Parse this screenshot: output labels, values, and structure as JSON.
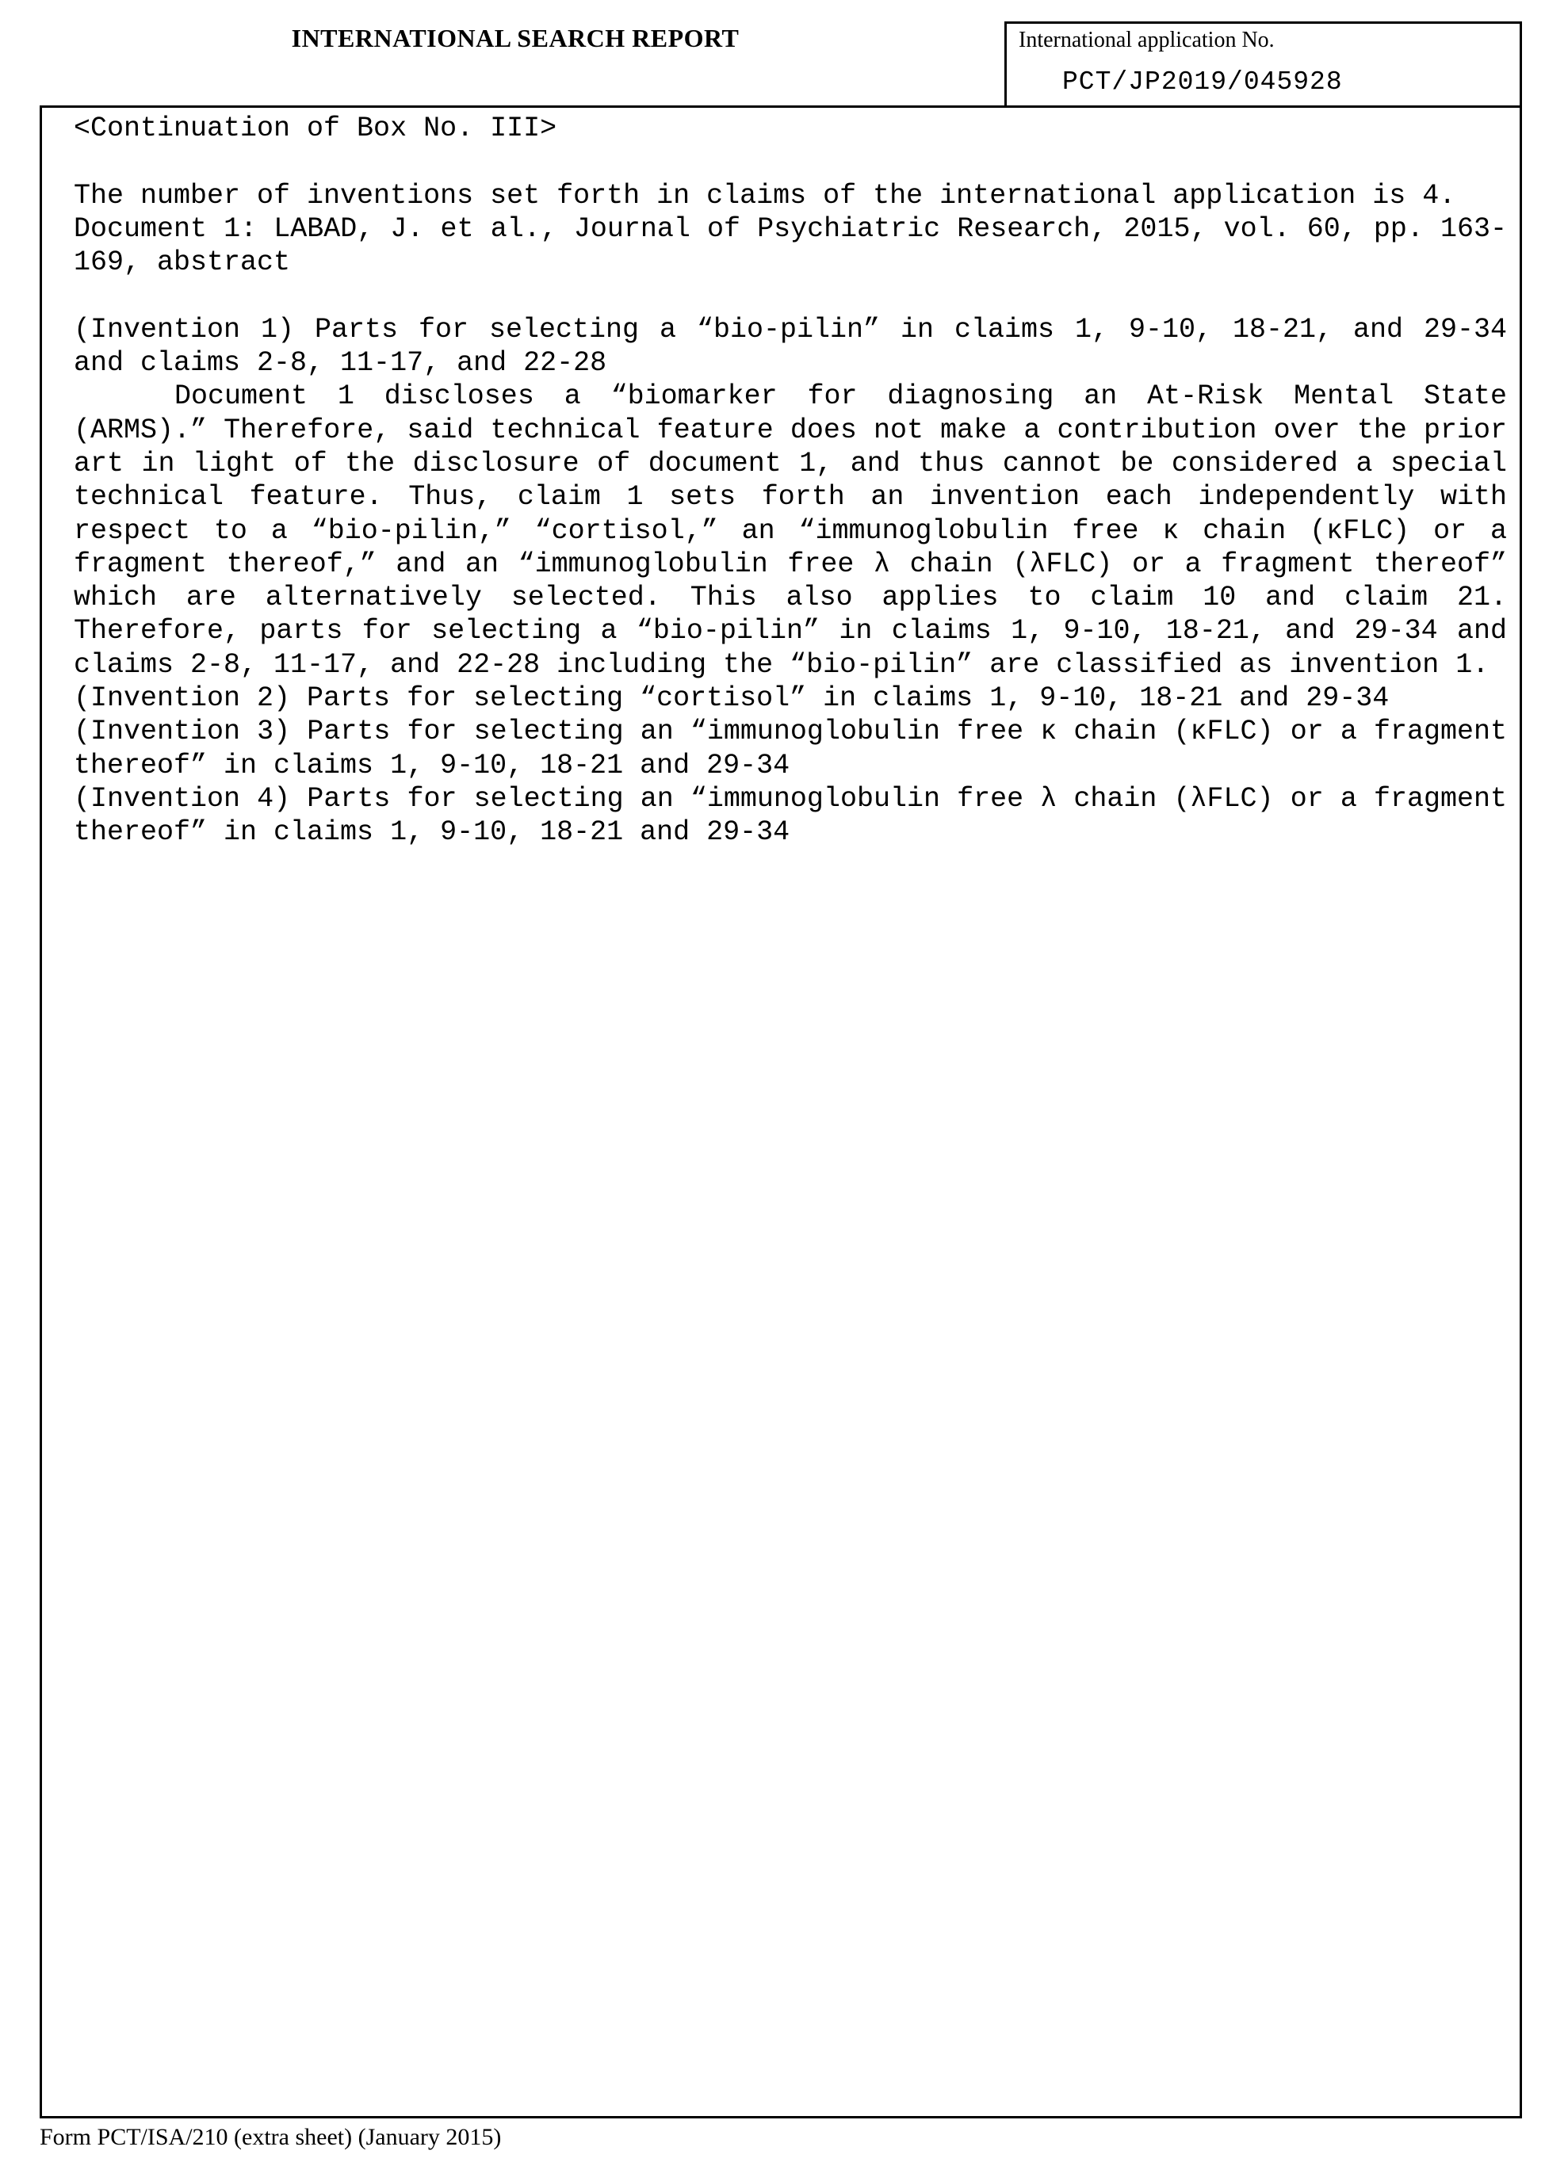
{
  "header": {
    "title": "INTERNATIONAL SEARCH REPORT",
    "application_label": "International application No.",
    "application_number": "PCT/JP2019/045928"
  },
  "body": {
    "box_heading": "<Continuation of Box No. III>",
    "inventions_count": "The number of inventions set forth in claims of the international application is 4.",
    "document_1": "Document 1: LABAD, J. et al., Journal of Psychiatric Research, 2015, vol. 60, pp. 163-169, abstract",
    "invention_1": "(Invention 1) Parts for selecting a “bio-pilin” in claims 1, 9-10, 18-21, and 29-34 and claims 2-8, 11-17, and 22-28",
    "explanation": "Document 1 discloses a “biomarker for diagnosing an At-Risk Mental State (ARMS).” Therefore, said technical feature does not make a contribution over the prior art in light of the disclosure of document 1, and thus cannot be considered a special technical feature. Thus, claim 1 sets forth an invention each independently with respect to a “bio-pilin,” “cortisol,” an “immunoglobulin free κ chain (κFLC) or a fragment thereof,” and an “immunoglobulin free λ chain (λFLC) or a fragment thereof” which are alternatively selected. This also applies to claim 10 and claim 21. Therefore, parts for selecting a “bio-pilin” in claims 1, 9-10, 18-21, and 29-34 and claims 2-8, 11-17, and 22-28 including the “bio-pilin” are classified as invention 1.",
    "invention_2": "(Invention 2) Parts for selecting “cortisol” in claims 1, 9-10, 18-21 and 29-34",
    "invention_3": "(Invention 3) Parts for selecting an “immunoglobulin free κ chain (κFLC) or a fragment thereof” in claims 1, 9-10, 18-21 and 29-34",
    "invention_4": "(Invention 4) Parts for selecting an “immunoglobulin free λ chain (λFLC) or a fragment thereof” in claims 1, 9-10, 18-21 and 29-34"
  },
  "footer": {
    "form_label": "Form PCT/ISA/210 (extra sheet) (January 2015)"
  }
}
